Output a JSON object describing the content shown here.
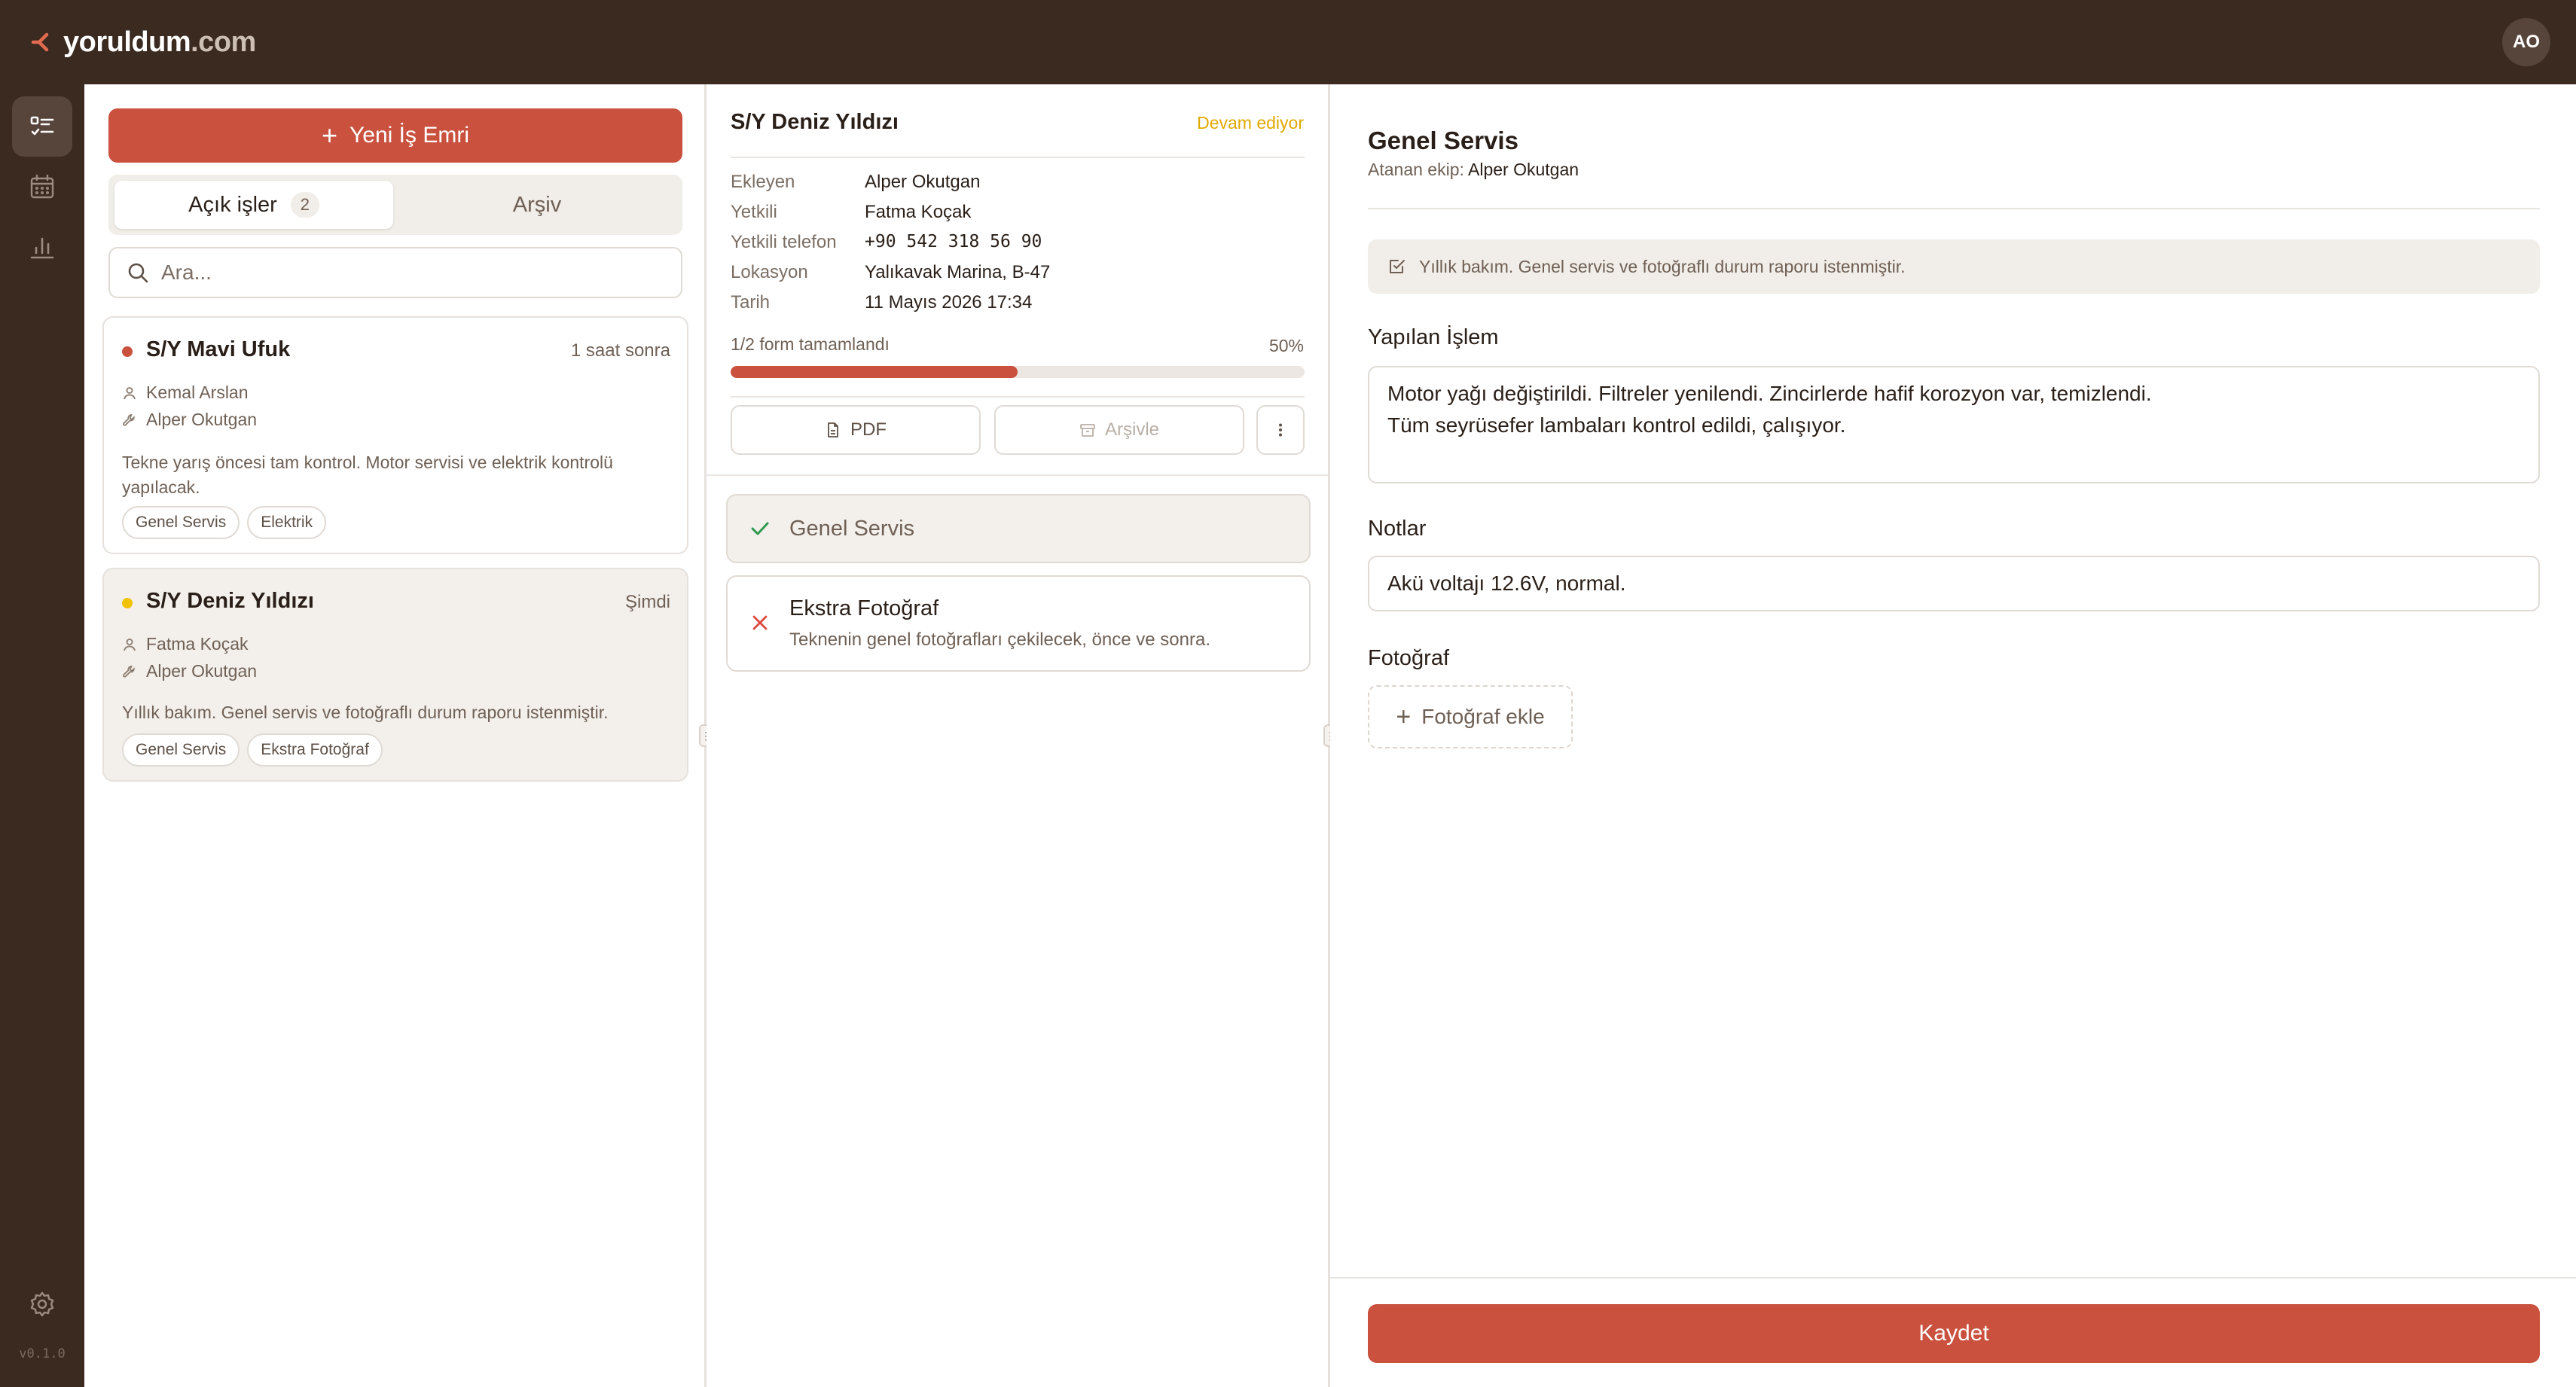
{
  "app": {
    "logo_main": "yoruldum",
    "logo_domain": ".com",
    "avatar_initials": "AO",
    "version": "v0.1.0",
    "accent_color": "#c9513e",
    "topbar_color": "#3a2a20"
  },
  "sidebar": {
    "items": [
      {
        "icon": "task-list-icon",
        "active": true
      },
      {
        "icon": "calendar-icon",
        "active": false
      },
      {
        "icon": "bar-chart-icon",
        "active": false
      }
    ],
    "settings_icon": "gear-icon"
  },
  "list_panel": {
    "new_button_label": "Yeni İş Emri",
    "tabs": [
      {
        "label": "Açık işler",
        "count": "2",
        "active": true
      },
      {
        "label": "Arşiv",
        "active": false
      }
    ],
    "search_placeholder": "Ara...",
    "jobs": [
      {
        "title": "S/Y Mavi Ufuk",
        "time": "1 saat sonra",
        "status_color": "#c9513e",
        "contact": "Kemal Arslan",
        "technician": "Alper Okutgan",
        "description": "Tekne yarış öncesi tam kontrol. Motor servisi ve elektrik kontrolü yapılacak.",
        "tags": [
          "Genel Servis",
          "Elektrik"
        ]
      },
      {
        "title": "S/Y Deniz Yıldızı",
        "time": "Şimdi",
        "status_color": "#f2c200",
        "contact": "Fatma Koçak",
        "technician": "Alper Okutgan",
        "description": "Yıllık bakım. Genel servis ve fotoğraflı durum raporu istenmiştir.",
        "tags": [
          "Genel Servis",
          "Ekstra Fotoğraf"
        ],
        "selected": true
      }
    ]
  },
  "detail_panel": {
    "title": "S/Y Deniz Yıldızı",
    "status": "Devam ediyor",
    "status_color": "#e1a800",
    "fields": [
      {
        "label": "Ekleyen",
        "value": "Alper Okutgan"
      },
      {
        "label": "Yetkili",
        "value": "Fatma Koçak"
      },
      {
        "label": "Yetkili telefon",
        "value": "+90 542 318 56 90"
      },
      {
        "label": "Lokasyon",
        "value": "Yalıkavak Marina, B-47"
      },
      {
        "label": "Tarih",
        "value": "11 Mayıs 2026 17:34"
      }
    ],
    "progress_label": "1/2 form tamamlandı",
    "progress_percent_text": "50%",
    "progress_value": 0.5,
    "pdf_label": "PDF",
    "archive_label": "Arşivle",
    "forms": [
      {
        "title": "Genel Servis",
        "subtitle": "",
        "done": true
      },
      {
        "title": "Ekstra Fotoğraf",
        "subtitle": "Teknenin genel fotoğrafları çekilecek, önce ve sonra.",
        "done": false
      }
    ]
  },
  "form_panel": {
    "title": "Genel Servis",
    "assigned_label": "Atanan ekip:",
    "assigned_value": "Alper Okutgan",
    "note": "Yıllık bakım. Genel servis ve fotoğraflı durum raporu istenmiştir.",
    "work_label": "Yapılan İşlem",
    "work_lines": [
      "Motor yağı değiştirildi. Filtreler yenilendi. Zincirlerde hafif korozyon var, temizlendi.",
      "Tüm seyrüsefer lambaları kontrol edildi, çalışıyor."
    ],
    "notes_label": "Notlar",
    "notes_value": "Akü voltajı 12.6V, normal.",
    "photo_label": "Fotoğraf",
    "add_photo_label": "Fotoğraf ekle",
    "save_label": "Kaydet"
  }
}
